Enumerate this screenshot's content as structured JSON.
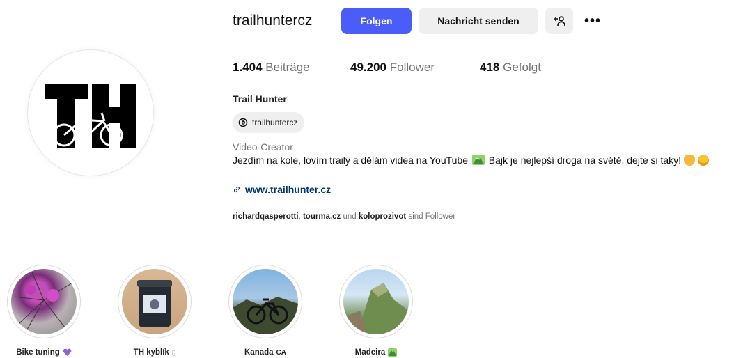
{
  "profile": {
    "username": "trailhuntercz",
    "follow_label": "Folgen",
    "message_label": "Nachricht senden",
    "full_name": "Trail Hunter",
    "threads_handle": "trailhuntercz",
    "category": "Video-Creator",
    "bio_line1": "Jezdím na kole, lovím traily a dělám videa na YouTube",
    "bio_line2": "Bajk je nejlepší droga na světě, dejte si taky!",
    "website": "www.trailhunter.cz",
    "avatar_text": "TH"
  },
  "stats": {
    "posts_count": "1.404",
    "posts_label": "Beiträge",
    "followers_count": "49.200",
    "followers_label": "Follower",
    "following_count": "418",
    "following_label": "Gefolgt"
  },
  "followed_by": {
    "user1": "richardqasperotti",
    "sep1": ", ",
    "user2": "tourma.cz",
    "and": " und ",
    "user3": "koloprozivot",
    "suffix": " sind Follower"
  },
  "highlights": [
    {
      "label": "Bike tuning",
      "suffix_icon": "purple-heart-icon"
    },
    {
      "label": "TH kyblík",
      "suffix": "▯"
    },
    {
      "label": "Kanada",
      "suffix": "CA"
    },
    {
      "label": "Madeira",
      "suffix_icon": "mountain-emoji-icon"
    }
  ],
  "colors": {
    "follow_button": "#4a5df9",
    "secondary_button": "#efefef",
    "link": "#00376b",
    "muted_text": "#737373"
  }
}
